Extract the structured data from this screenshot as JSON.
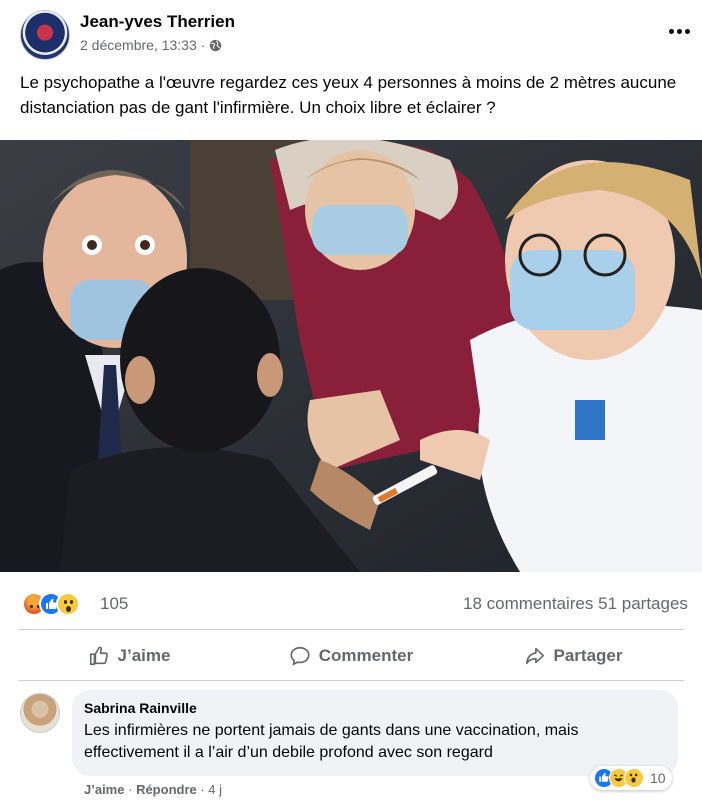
{
  "post": {
    "author": "Jean-yves Therrien",
    "timestamp": "2 décembre, 13:33 ·",
    "privacy_icon": "globe-icon",
    "text": "Le psychopathe a l'œuvre regardez ces yeux 4 personnes à moins de 2 mètres aucune distanciation pas de gant l'infirmière. Un choix libre et éclairer ?"
  },
  "reactions": {
    "icons": [
      "angry-icon",
      "like-icon",
      "wow-icon"
    ],
    "count": "105",
    "comments_shares": "18 commentaires  51 partages"
  },
  "actions": {
    "like": "J’aime",
    "comment": "Commenter",
    "share": "Partager"
  },
  "comment": {
    "author": "Sabrina Rainville",
    "text": "Les infirmières ne portent jamais de gants dans une vaccination, mais effectivement il a l’air d’un debile profond avec son regard",
    "reaction_count": "10",
    "like_link": "J’aime",
    "reply_link": "Répondre",
    "age": "· 4 j"
  },
  "colors": {
    "link_blue": "#1877f2",
    "secondary_text": "#65676b",
    "bubble_bg": "#f0f2f5"
  }
}
